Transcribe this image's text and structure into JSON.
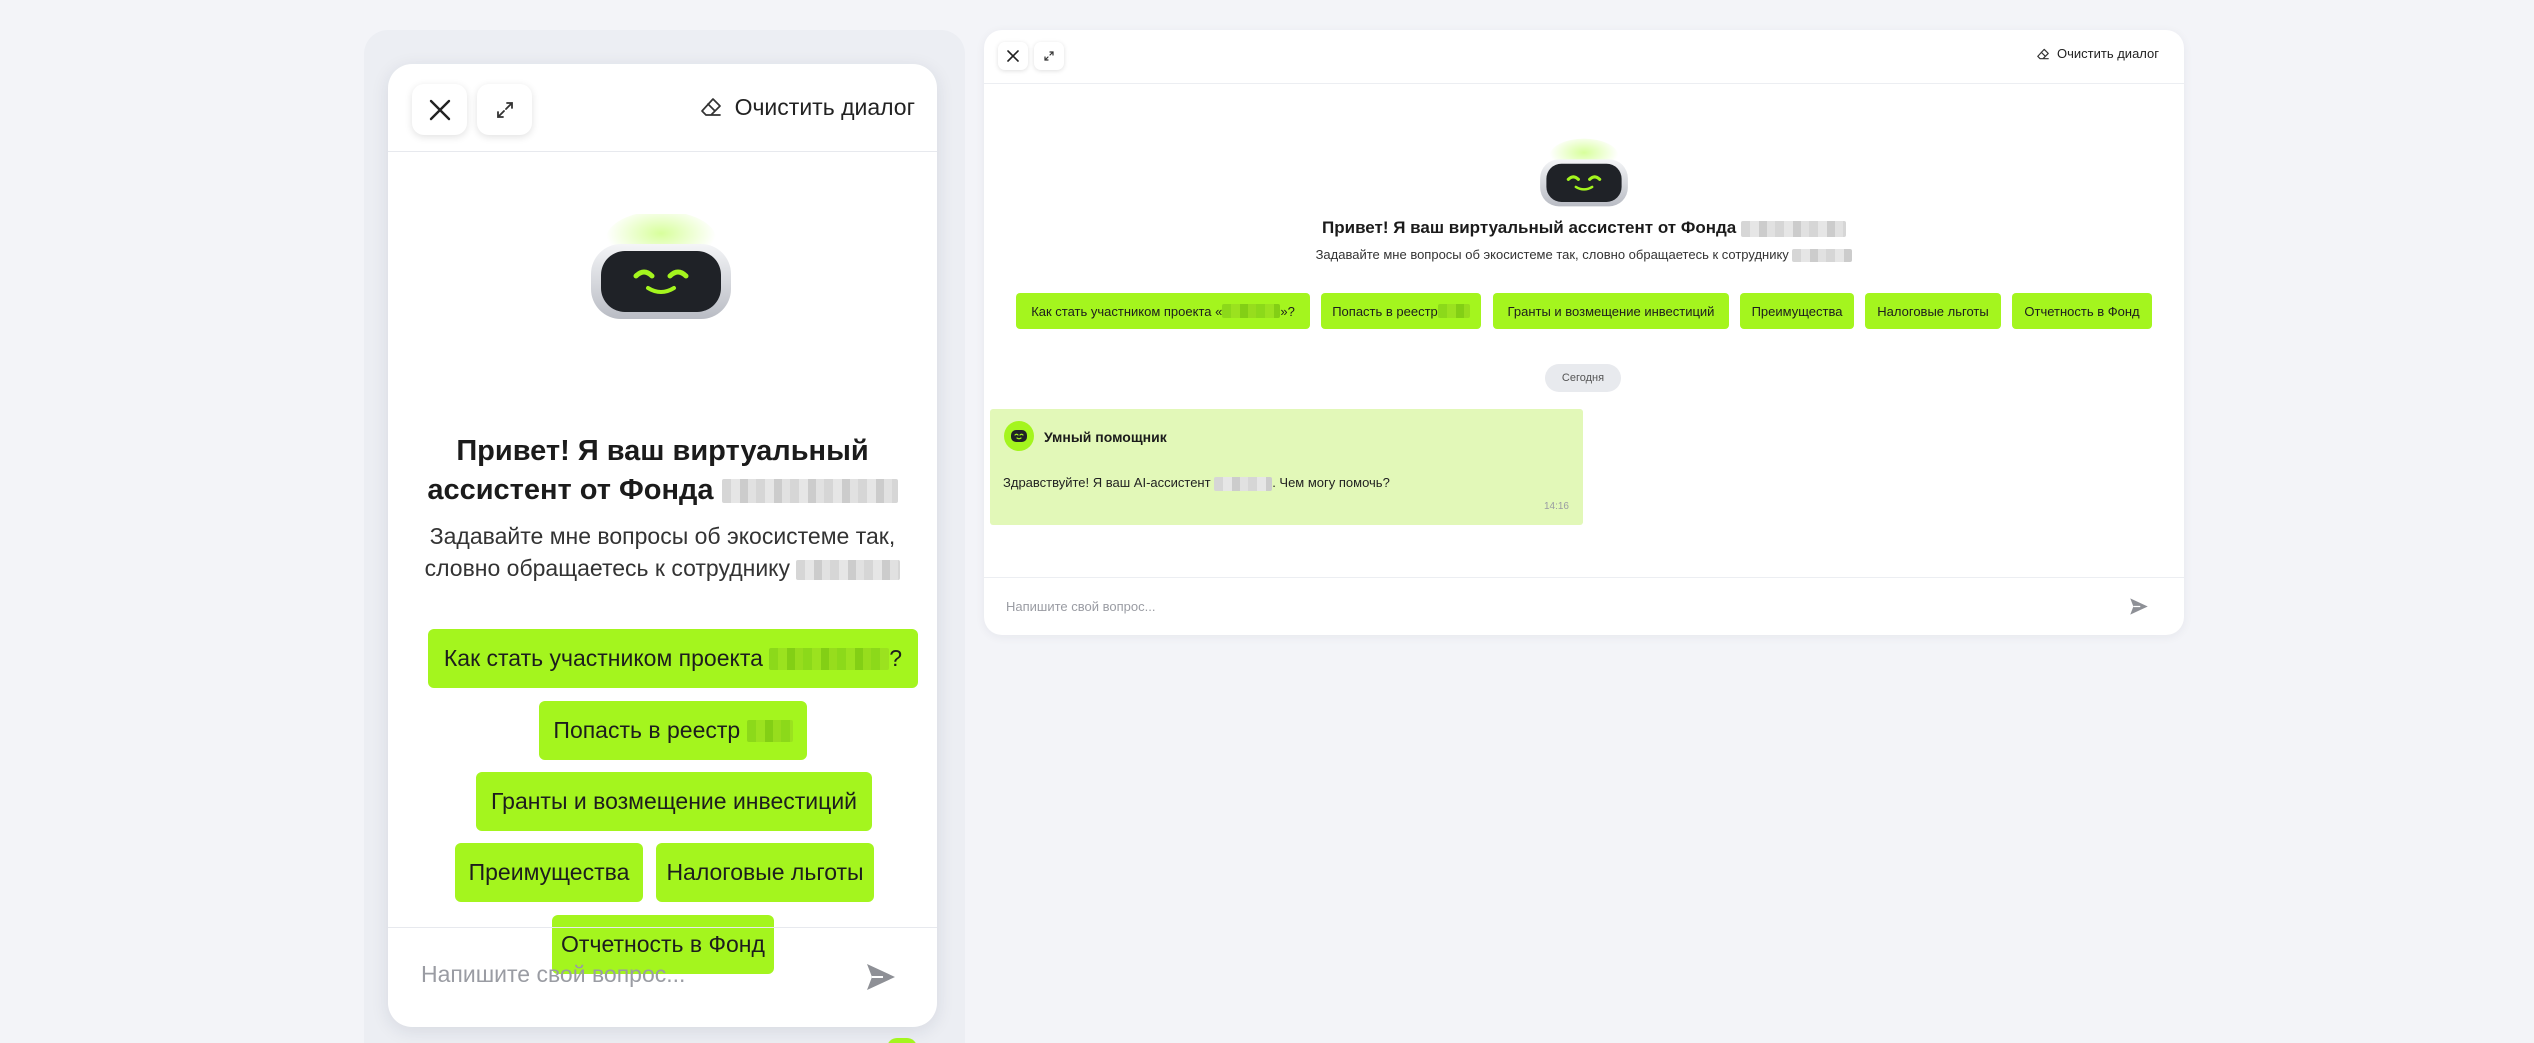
{
  "mobile": {
    "clear_label": "Очистить диалог",
    "greeting_title": "Привет! Я ваш виртуальный ассистент от Фонда",
    "greeting_sub": "Задавайте мне вопросы об экосистеме так, словно обращаетесь к сотруднику",
    "chips": {
      "c1_prefix": "Как стать участником проекта",
      "c1_suffix": "?",
      "c2": "Попасть в реестр",
      "c3": "Гранты и возмещение инвестиций",
      "c4": "Преимущества",
      "c5": "Налоговые льготы",
      "c6": "Отчетность в Фонд"
    },
    "input_placeholder": "Напишите свой вопрос..."
  },
  "desktop": {
    "clear_label": "Очистить диалог",
    "greeting_title": "Привет! Я ваш виртуальный ассистент от Фонда",
    "greeting_sub": "Задавайте мне вопросы об экосистеме так, словно обращаетесь к сотруднику",
    "chips": {
      "c1_prefix": "Как стать участником проекта «",
      "c1_suffix": "»?",
      "c2": "Попасть в реестр",
      "c3": "Гранты и возмещение инвестиций",
      "c4": "Преимущества",
      "c5": "Налоговые льготы",
      "c6": "Отчетность в Фонд"
    },
    "date_separator": "Сегодня",
    "message": {
      "author": "Умный помощник",
      "text_prefix": "Здравствуйте! Я ваш AI-ассистент",
      "text_suffix": ". Чем могу помочь?",
      "time": "14:16"
    },
    "input_placeholder": "Напишите свой вопрос..."
  },
  "colors": {
    "accent": "#a4f51e",
    "message_bg": "#e2f8b8",
    "page_bg": "#f3f4f8"
  },
  "icons": [
    "close-icon",
    "expand-icon",
    "eraser-icon",
    "send-icon",
    "robot-avatar-icon"
  ]
}
